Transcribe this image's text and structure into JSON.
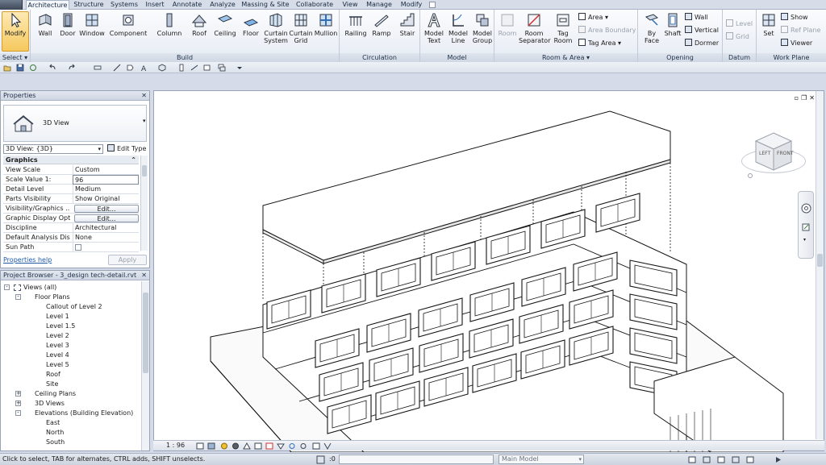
{
  "tabs": [
    "Architecture",
    "Structure",
    "Systems",
    "Insert",
    "Annotate",
    "Analyze",
    "Massing & Site",
    "Collaborate",
    "View",
    "Manage",
    "Modify"
  ],
  "ribbon": {
    "panels": {
      "select": "Select ▾",
      "build": "Build",
      "circulation": "Circulation",
      "model": "Model",
      "room_area": "Room & Area ▾",
      "opening": "Opening",
      "datum": "Datum",
      "work_plane": "Work Plane"
    },
    "buttons": {
      "modify": "Modify",
      "wall": "Wall",
      "door": "Door",
      "window": "Window",
      "component": "Component",
      "column": "Column",
      "roof": "Roof",
      "ceiling": "Ceiling",
      "floor": "Floor",
      "curtain_system": "Curtain System",
      "curtain_grid": "Curtain Grid",
      "mullion": "Mullion",
      "railing": "Railing",
      "ramp": "Ramp",
      "stair": "Stair",
      "model_text": "Model Text",
      "model_line": "Model Line",
      "model_group": "Model Group",
      "room": "Room",
      "room_separator": "Room Separator",
      "tag_room": "Tag Room",
      "area": "Area ▾",
      "area_boundary": "Area Boundary",
      "tag_area": "Tag Area ▾",
      "by_face": "By Face",
      "shaft": "Shaft",
      "op_wall": "Wall",
      "vertical": "Vertical",
      "dormer": "Dormer",
      "level": "Level",
      "grid": "Grid",
      "set": "Set",
      "show": "Show",
      "ref_plane": "Ref Plane",
      "viewer": "Viewer"
    }
  },
  "properties": {
    "title": "Properties",
    "type_name": "3D View",
    "instance_select": "3D View: {3D}",
    "edit_type": "Edit Type",
    "group": "Graphics",
    "rows": [
      {
        "k": "View Scale",
        "v": "Custom"
      },
      {
        "k": "Scale Value    1:",
        "v": "96"
      },
      {
        "k": "Detail Level",
        "v": "Medium"
      },
      {
        "k": "Parts Visibility",
        "v": "Show Original"
      },
      {
        "k": "Visibility/Graphics ...",
        "v": "Edit..."
      },
      {
        "k": "Graphic Display Opt...",
        "v": "Edit..."
      },
      {
        "k": "Discipline",
        "v": "Architectural"
      },
      {
        "k": "Default Analysis Dis...",
        "v": "None"
      },
      {
        "k": "Sun Path",
        "v": ""
      }
    ],
    "help": "Properties help",
    "apply": "Apply"
  },
  "browser": {
    "title": "Project Browser - 3_design tech-detail.rvt",
    "items": [
      {
        "t": "Views (all)",
        "lvl": 0,
        "exp": "-"
      },
      {
        "t": "Floor Plans",
        "lvl": 1,
        "exp": "-"
      },
      {
        "t": "Callout of Level 2",
        "lvl": 2,
        "exp": ""
      },
      {
        "t": "Level 1",
        "lvl": 2,
        "exp": ""
      },
      {
        "t": "Level 1.5",
        "lvl": 2,
        "exp": ""
      },
      {
        "t": "Level 2",
        "lvl": 2,
        "exp": ""
      },
      {
        "t": "Level 3",
        "lvl": 2,
        "exp": ""
      },
      {
        "t": "Level 4",
        "lvl": 2,
        "exp": ""
      },
      {
        "t": "Level 5",
        "lvl": 2,
        "exp": ""
      },
      {
        "t": "Roof",
        "lvl": 2,
        "exp": ""
      },
      {
        "t": "Site",
        "lvl": 2,
        "exp": ""
      },
      {
        "t": "Ceiling Plans",
        "lvl": 1,
        "exp": "+"
      },
      {
        "t": "3D Views",
        "lvl": 1,
        "exp": "+"
      },
      {
        "t": "Elevations (Building Elevation)",
        "lvl": 1,
        "exp": "-"
      },
      {
        "t": "East",
        "lvl": 2,
        "exp": ""
      },
      {
        "t": "North",
        "lvl": 2,
        "exp": ""
      },
      {
        "t": "South",
        "lvl": 2,
        "exp": ""
      }
    ]
  },
  "viewcube": {
    "left": "LEFT",
    "front": "FRONT"
  },
  "viewbar": {
    "scale": "1 : 96"
  },
  "status": {
    "message": "Click to select, TAB for alternates, CTRL adds, SHIFT unselects.",
    "count": ":0",
    "model": "Main Model"
  },
  "colors": {
    "accent": "#2f6fb6",
    "ribbon_bg": "#eef2f8",
    "panel_label": "#cfd7e3"
  }
}
